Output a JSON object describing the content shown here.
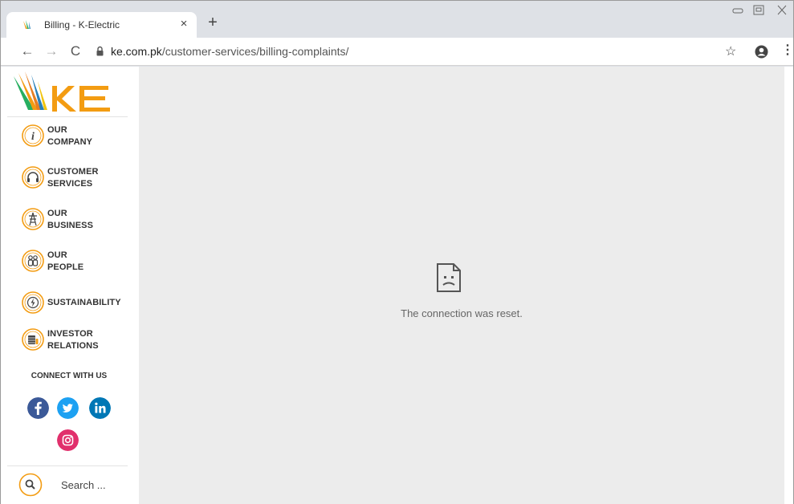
{
  "browser": {
    "tab_title": "Billing - K-Electric",
    "tab_close": "×",
    "new_tab": "+",
    "url_host": "ke.com.pk",
    "url_path": "/customer-services/billing-complaints/",
    "back": "←",
    "forward": "→",
    "reload": "C",
    "star": "☆",
    "menu": "⋮"
  },
  "sidebar": {
    "logo_text": "KE",
    "items": [
      {
        "label": "OUR\nCOMPANY",
        "icon": "info-icon"
      },
      {
        "label": "CUSTOMER\nSERVICES",
        "icon": "headphones-icon"
      },
      {
        "label": "OUR\nBUSINESS",
        "icon": "power-tower-icon"
      },
      {
        "label": "OUR\nPEOPLE",
        "icon": "people-icon"
      },
      {
        "label": "SUSTAINABILITY",
        "icon": "lightning-icon"
      },
      {
        "label": "INVESTOR\nRELATIONS",
        "icon": "coins-icon"
      }
    ],
    "connect_label": "CONNECT WITH US",
    "search_placeholder": "Search ..."
  },
  "colors": {
    "brand_orange": "#f39c12",
    "facebook": "#3b5998",
    "twitter": "#1da1f2",
    "linkedin": "#0077b5",
    "instagram": "#e1306c"
  },
  "content": {
    "error_message": "The connection was reset."
  }
}
